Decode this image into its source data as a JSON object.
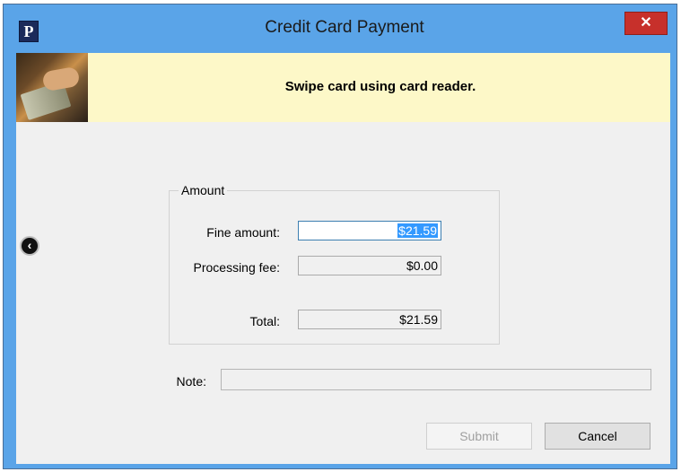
{
  "window": {
    "title": "Credit Card Payment",
    "app_icon_letter": "P",
    "close_glyph": "✕"
  },
  "banner": {
    "message": "Swipe card using card reader.",
    "image_icon": "credit-card-swipe-photo"
  },
  "nav": {
    "back_icon": "chevron-left-circle-icon",
    "back_glyph": "‹"
  },
  "amount_group": {
    "legend": "Amount",
    "fine_label": "Fine amount:",
    "fine_value": "$21.59",
    "fee_label": "Processing fee:",
    "fee_value": "$0.00",
    "total_label": "Total:",
    "total_value": "$21.59"
  },
  "note": {
    "label": "Note:",
    "value": ""
  },
  "buttons": {
    "submit": "Submit",
    "cancel": "Cancel"
  },
  "colors": {
    "titlebar": "#5aa4e8",
    "close_button": "#c7302b",
    "banner_bg": "#fdf8c8",
    "client_bg": "#f0f0f0",
    "selection": "#3399ff"
  }
}
